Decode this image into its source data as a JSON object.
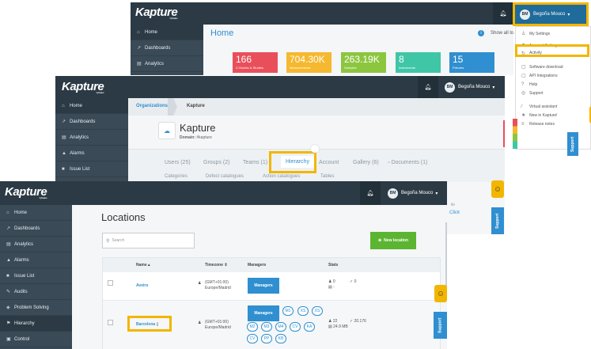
{
  "screen1": {
    "logo": "Kapture",
    "logo_sub": "by Kapture",
    "user_initials": "BM",
    "user_name": "Begoña Mouco",
    "caret": "▾",
    "sidebar": [
      {
        "label": "Home",
        "icon": "home-icon",
        "glyph": "⌂"
      },
      {
        "label": "Dashboards",
        "icon": "chart-icon",
        "glyph": "↗"
      },
      {
        "label": "Analytics",
        "icon": "analytics-icon",
        "glyph": "▤"
      }
    ],
    "page_title": "Home",
    "show_all": "Show all lo",
    "info_glyph": "i",
    "tiles": [
      {
        "value": "166",
        "label": "C.Guides & Studies",
        "color": "#e94f5b"
      },
      {
        "value": "704.30K",
        "label": "Measurements",
        "color": "#f5b82e"
      },
      {
        "value": "263.19K",
        "label": "Samples",
        "color": "#8cc63f"
      },
      {
        "value": "8",
        "label": "Instruments",
        "color": "#3fc6a6"
      },
      {
        "value": "15",
        "label": "Fixtures",
        "color": "#2f8fd0"
      }
    ]
  },
  "dropdown": {
    "items": [
      {
        "label": "My Settings",
        "icon": "user-icon",
        "glyph": "♙"
      },
      {
        "label": "Account Settings",
        "icon": "gear-icon",
        "glyph": "⚙"
      },
      {
        "label": "Activity",
        "icon": "activity-icon",
        "glyph": "↻"
      },
      {
        "label": "Software download",
        "icon": "download-icon",
        "glyph": "▢"
      },
      {
        "label": "API Integrations",
        "icon": "api-icon",
        "glyph": "▢"
      },
      {
        "label": "Help",
        "icon": "help-icon",
        "glyph": "?"
      },
      {
        "label": "Support",
        "icon": "support-icon",
        "glyph": "◎"
      },
      {
        "label": "Virtual assistant",
        "icon": "wand-icon",
        "glyph": "⁄"
      },
      {
        "label": "New in Kapture!",
        "icon": "star-icon",
        "glyph": "★"
      },
      {
        "label": "Release notes",
        "icon": "list-icon",
        "glyph": "≡"
      }
    ],
    "support_tab": "Support",
    "smiley": "☺"
  },
  "screen2": {
    "logo": "Kapture",
    "logo_sub": "by Kapture",
    "user_initials": "BM",
    "user_name": "Begoña Mouco",
    "sidebar": [
      {
        "label": "Home",
        "icon": "home-icon",
        "glyph": "⌂"
      },
      {
        "label": "Dashboards",
        "icon": "chart-icon",
        "glyph": "↗"
      },
      {
        "label": "Analytics",
        "icon": "analytics-icon",
        "glyph": "▤"
      },
      {
        "label": "Alarms",
        "icon": "alarm-icon",
        "glyph": "▲"
      },
      {
        "label": "Issue List",
        "icon": "issue-icon",
        "glyph": "■"
      }
    ],
    "breadcrumb_root": "Organizations",
    "breadcrumb_current": "Kapture",
    "org_name": "Kapture",
    "domain_label": "Domain:",
    "domain_value": "#kapture",
    "tabs": [
      "Users (25)",
      "Groups (2)",
      "Teams (1)",
      "Hierarchy",
      "Account",
      "Gallery (6)",
      "Documents (1)"
    ],
    "subtabs": [
      "Categories",
      "Defect catalogues",
      "Action catalogues",
      "Tables"
    ],
    "side_text_1": "ile",
    "side_text_2": "Click"
  },
  "screen3": {
    "logo": "Kapture",
    "logo_sub": "by Kapture",
    "user_initials": "BM",
    "user_name": "Begoña Mouco",
    "sidebar": [
      {
        "label": "Home",
        "icon": "home-icon",
        "glyph": "⌂"
      },
      {
        "label": "Dashboards",
        "icon": "chart-icon",
        "glyph": "↗"
      },
      {
        "label": "Analytics",
        "icon": "analytics-icon",
        "glyph": "▤"
      },
      {
        "label": "Alarms",
        "icon": "alarm-icon",
        "glyph": "▲"
      },
      {
        "label": "Issue List",
        "icon": "issue-icon",
        "glyph": "■"
      },
      {
        "label": "Audits",
        "icon": "audit-icon",
        "glyph": "✎"
      },
      {
        "label": "Problem Solving",
        "icon": "problem-icon",
        "glyph": "◈"
      },
      {
        "label": "Hierarchy",
        "icon": "hierarchy-icon",
        "glyph": "⚑"
      },
      {
        "label": "Control",
        "icon": "control-icon",
        "glyph": "▣"
      }
    ],
    "page_title": "Locations",
    "search_placeholder": "Search",
    "new_location": "New location",
    "columns": {
      "name": "Name ▴",
      "timezone": "Timezone ⇕",
      "managers": "Managers",
      "stats": "Stats"
    },
    "rows": [
      {
        "name": "Aveiro",
        "timezone": "(GMT+01:00) Europe/Madrid",
        "manager_btn": "Managers",
        "stat_a": "0",
        "stat_b": "0",
        "stat_c": "-",
        "pills": []
      },
      {
        "name": "Barcelona",
        "timezone": "(GMT+01:00) Europe/Madrid",
        "manager_btn": "Managers",
        "stat_a": "22",
        "stat_b": "20.176",
        "stat_c": "24.9 MB",
        "pills": [
          "M1",
          "XS",
          "XS",
          "M2",
          "M3",
          "M4",
          "CV",
          "KA",
          "CV",
          "PP",
          "KB"
        ]
      }
    ],
    "support_tab": "Support",
    "smiley": "☺"
  },
  "colors": {
    "topbar": "#2b3a44",
    "sidebar": "#3a4a56",
    "accent": "#2f8fd0",
    "highlight": "#f2b600",
    "green": "#5cb531"
  }
}
